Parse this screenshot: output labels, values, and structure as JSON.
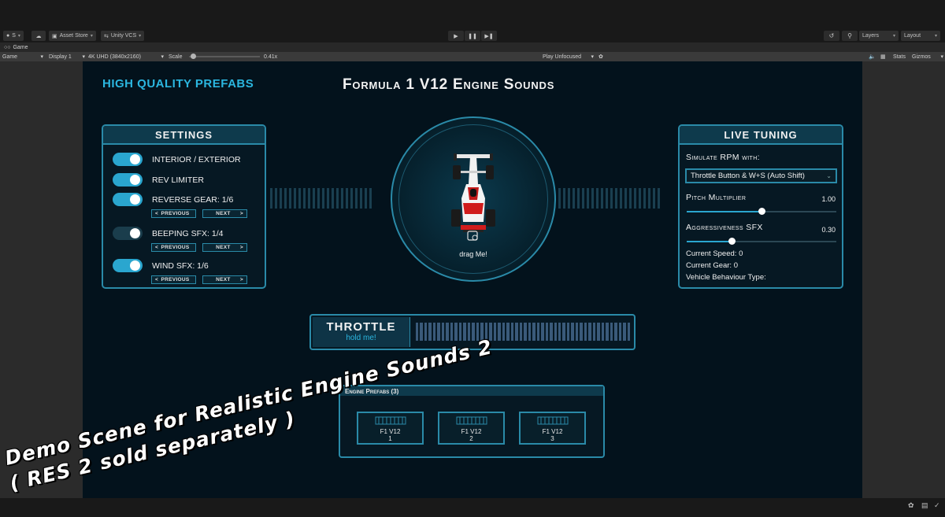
{
  "editor": {
    "account_label": "S",
    "asset_store_label": "Asset Store",
    "vcs_label": "Unity VCS",
    "layers_label": "Layers",
    "layout_label": "Layout",
    "tab_label": "Game",
    "view_select": "Game",
    "display_select": "Display 1",
    "resolution_select": "4K UHD (3840x2160)",
    "scale_label": "Scale",
    "scale_value": "0.41x",
    "scale_level": 0.05,
    "play_mode_select": "Play Unfocused",
    "stats_label": "Stats",
    "gizmos_label": "Gizmos",
    "accent_color": "#2aa6cf"
  },
  "game": {
    "brand": "HIGH QUALITY PREFABS",
    "title": "Formula 1 V12 Engine Sounds",
    "settings": {
      "header": "SETTINGS",
      "items": [
        {
          "label": "INTERIOR / EXTERIOR",
          "on": true
        },
        {
          "label": "REV LIMITER",
          "on": true
        },
        {
          "label": "REVERSE GEAR: 1/6",
          "on": true
        },
        {
          "label": "BEEPING SFX: 1/4",
          "on": false
        },
        {
          "label": "WIND SFX: 1/6",
          "on": true
        }
      ],
      "previous_label": "PREVIOUS",
      "next_label": "NEXT"
    },
    "car": {
      "drag_label": "drag Me!"
    },
    "live_tuning": {
      "header": "LIVE TUNING",
      "simulate_label": "Simulate RPM with:",
      "simulate_selected": "Throttle Button & W+S (Auto Shift)",
      "pitch_label": "Pitch Multiplier",
      "pitch_value": "1.00",
      "pitch_level": 0.5,
      "aggr_label": "Aggressiveness SFX",
      "aggr_value": "0.30",
      "aggr_level": 0.3,
      "current_speed": "Current Speed: 0",
      "current_gear": "Current Gear: 0",
      "vehicle_behaviour": "Vehicle Behaviour Type:"
    },
    "throttle": {
      "title": "THROTTLE",
      "subtitle": "hold me!",
      "level": 0
    },
    "prefabs": {
      "header": "Engine Prefabs (3)",
      "items": [
        {
          "name": "F1 V12",
          "number": "1"
        },
        {
          "name": "F1 V12",
          "number": "2"
        },
        {
          "name": "F1 V12",
          "number": "3"
        }
      ]
    }
  },
  "watermark": {
    "line1": "Demo  Scene  for  Realistic Engine Sounds 2",
    "line2": "( RES 2 sold separately )"
  }
}
